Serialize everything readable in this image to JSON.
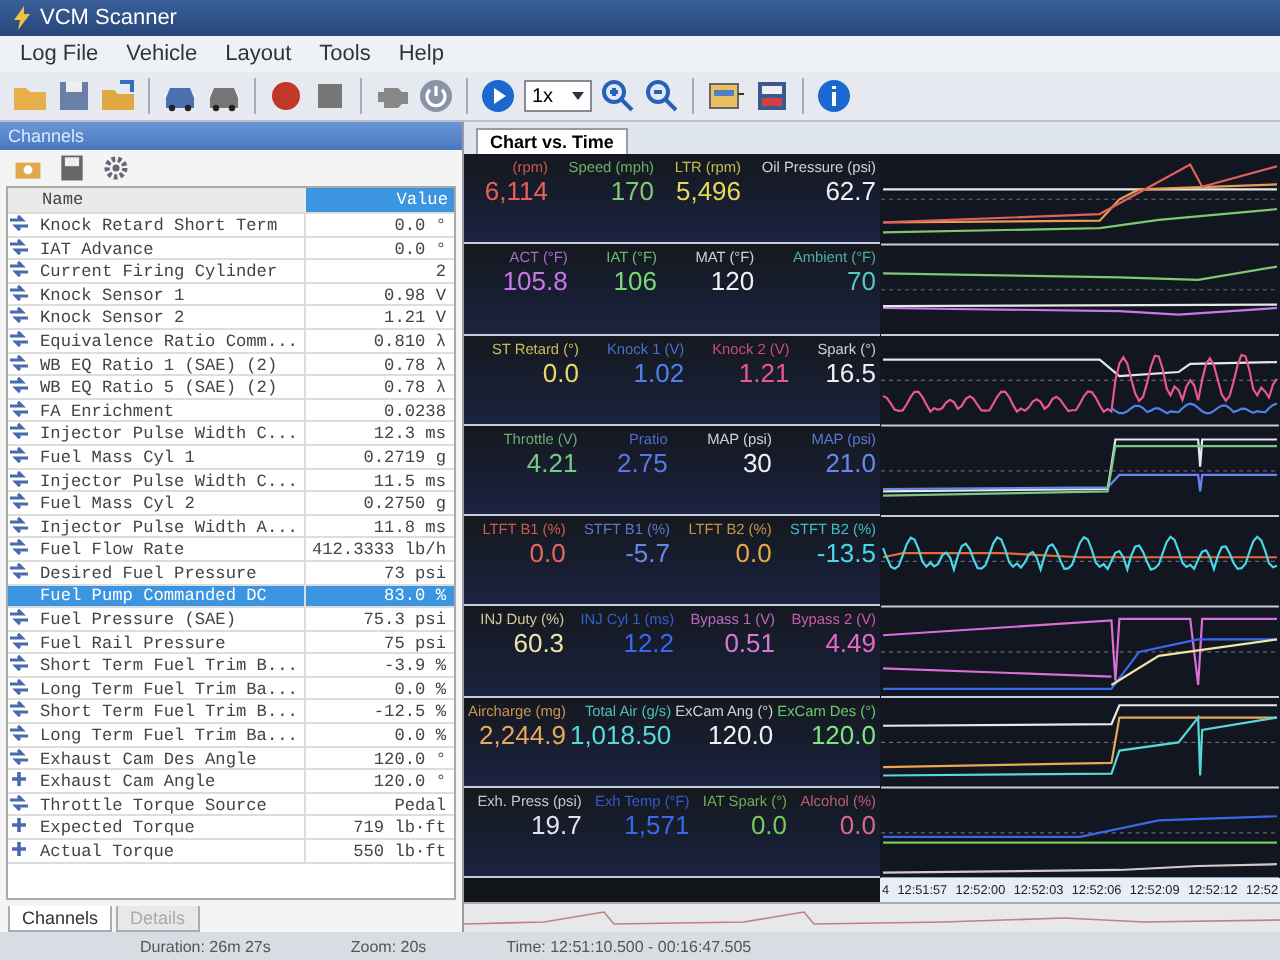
{
  "window": {
    "title": "VCM Scanner"
  },
  "menu": [
    "Log File",
    "Vehicle",
    "Layout",
    "Tools",
    "Help"
  ],
  "toolbar": {
    "speed": "1x"
  },
  "channels_panel": {
    "title": "Channels",
    "columns": [
      {
        "label": "Name",
        "selected": false
      },
      {
        "label": "Value",
        "selected": true
      }
    ],
    "rows": [
      {
        "name": "Knock Retard Short Term",
        "value": "0.0 °",
        "kind": "dual",
        "selected": false
      },
      {
        "name": "IAT Advance",
        "value": "0.0 °",
        "kind": "dual",
        "selected": false
      },
      {
        "name": "Current Firing Cylinder",
        "value": "2",
        "kind": "dual",
        "selected": false
      },
      {
        "name": "Knock Sensor 1",
        "value": "0.98 V",
        "kind": "dual",
        "selected": false
      },
      {
        "name": "Knock Sensor 2",
        "value": "1.21 V",
        "kind": "dual",
        "selected": false
      },
      {
        "name": "Equivalence Ratio Comm...",
        "value": "0.810 λ",
        "kind": "dual",
        "selected": false
      },
      {
        "name": "WB EQ Ratio 1 (SAE) (2)",
        "value": "0.78 λ",
        "kind": "dual",
        "selected": false
      },
      {
        "name": "WB EQ Ratio 5 (SAE) (2)",
        "value": "0.78 λ",
        "kind": "dual",
        "selected": false
      },
      {
        "name": "FA Enrichment",
        "value": "0.0238",
        "kind": "dual",
        "selected": false
      },
      {
        "name": "Injector Pulse Width C...",
        "value": "12.3 ms",
        "kind": "dual",
        "selected": false
      },
      {
        "name": "Fuel Mass Cyl 1",
        "value": "0.2719 g",
        "kind": "dual",
        "selected": false
      },
      {
        "name": "Injector Pulse Width C...",
        "value": "11.5 ms",
        "kind": "dual",
        "selected": false
      },
      {
        "name": "Fuel Mass Cyl 2",
        "value": "0.2750 g",
        "kind": "dual",
        "selected": false
      },
      {
        "name": "Injector Pulse Width A...",
        "value": "11.8 ms",
        "kind": "dual",
        "selected": false
      },
      {
        "name": "Fuel Flow Rate",
        "value": "412.3333 lb/h",
        "kind": "dual",
        "selected": false
      },
      {
        "name": "Desired Fuel Pressure",
        "value": "73 psi",
        "kind": "dual",
        "selected": false
      },
      {
        "name": "Fuel Pump Commanded DC",
        "value": "83.0 %",
        "kind": "none",
        "selected": true
      },
      {
        "name": "Fuel Pressure (SAE)",
        "value": "75.3 psi",
        "kind": "dual",
        "selected": false
      },
      {
        "name": "Fuel Rail Pressure",
        "value": "75 psi",
        "kind": "dual",
        "selected": false
      },
      {
        "name": "Short Term Fuel Trim B...",
        "value": "-3.9 %",
        "kind": "dual",
        "selected": false
      },
      {
        "name": "Long Term Fuel Trim Ba...",
        "value": "0.0 %",
        "kind": "dual",
        "selected": false
      },
      {
        "name": "Short Term Fuel Trim B...",
        "value": "-12.5 %",
        "kind": "dual",
        "selected": false
      },
      {
        "name": "Long Term Fuel Trim Ba...",
        "value": "0.0 %",
        "kind": "dual",
        "selected": false
      },
      {
        "name": "Exhaust Cam Des Angle",
        "value": "120.0 °",
        "kind": "dual",
        "selected": false
      },
      {
        "name": "Exhaust Cam Angle",
        "value": "120.0 °",
        "kind": "single",
        "selected": false
      },
      {
        "name": "Throttle Torque Source",
        "value": "Pedal",
        "kind": "dual",
        "selected": false
      },
      {
        "name": "Expected Torque",
        "value": "719 lb·ft",
        "kind": "single",
        "selected": false
      },
      {
        "name": "Actual Torque",
        "value": "550 lb·ft",
        "kind": "single",
        "selected": false
      }
    ],
    "tabs": [
      {
        "label": "Channels",
        "selected": true
      },
      {
        "label": "Details",
        "selected": false
      }
    ]
  },
  "chart_tab": {
    "label": "Chart vs. Time"
  },
  "gauge_groups": [
    {
      "items": [
        {
          "label": "(rpm)",
          "value": "6,114",
          "color": "#e86058"
        },
        {
          "label": "Speed (mph)",
          "value": "170",
          "color": "#80c870"
        },
        {
          "label": "LTR (rpm)",
          "value": "5,496",
          "color": "#e8d858"
        },
        {
          "label": "Oil Pressure (psi)",
          "value": "62.7",
          "color": "#f0f0f0"
        }
      ]
    },
    {
      "items": [
        {
          "label": "ACT (°F)",
          "value": "105.8",
          "color": "#c878e8"
        },
        {
          "label": "IAT (°F)",
          "value": "106",
          "color": "#78d878"
        },
        {
          "label": "MAT (°F)",
          "value": "120",
          "color": "#f0f0f0"
        },
        {
          "label": "Ambient (°F)",
          "value": "70",
          "color": "#58c8b8"
        }
      ]
    },
    {
      "items": [
        {
          "label": "ST Retard (°)",
          "value": "0.0",
          "color": "#e8d868"
        },
        {
          "label": "Knock 1 (V)",
          "value": "1.02",
          "color": "#5080e8"
        },
        {
          "label": "Knock 2 (V)",
          "value": "1.21",
          "color": "#e85888"
        },
        {
          "label": "Spark (°)",
          "value": "16.5",
          "color": "#f0f0f0"
        }
      ]
    },
    {
      "items": [
        {
          "label": "Throttle (V)",
          "value": "4.21",
          "color": "#78c888"
        },
        {
          "label": "Pratio",
          "value": "2.75",
          "color": "#5878e8"
        },
        {
          "label": "MAP (psi)",
          "value": "30",
          "color": "#f0f0f0"
        },
        {
          "label": "MAP (psi)",
          "value": "21.0",
          "color": "#6888f0"
        }
      ]
    },
    {
      "items": [
        {
          "label": "LTFT B1 (%)",
          "value": "0.0",
          "color": "#e86858"
        },
        {
          "label": "STFT B1 (%)",
          "value": "-5.7",
          "color": "#6888e8"
        },
        {
          "label": "LTFT B2 (%)",
          "value": "0.0",
          "color": "#e8a848"
        },
        {
          "label": "STFT B2 (%)",
          "value": "-13.5",
          "color": "#48d8e8"
        }
      ]
    },
    {
      "items": [
        {
          "label": "INJ Duty (%)",
          "value": "60.3",
          "color": "#f0e4a8"
        },
        {
          "label": "INJ Cyl 1 (ms)",
          "value": "12.2",
          "color": "#3868f0"
        },
        {
          "label": "Bypass 1 (V)",
          "value": "0.51",
          "color": "#d878d8"
        },
        {
          "label": "Bypass 2 (V)",
          "value": "4.49",
          "color": "#e868c8"
        }
      ]
    },
    {
      "items": [
        {
          "label": "Aircharge (mg)",
          "value": "2,244.9",
          "color": "#e8a858"
        },
        {
          "label": "Total Air (g/s)",
          "value": "1,018.50",
          "color": "#58d8d8"
        },
        {
          "label": "ExCam Ang (°)",
          "value": "120.0",
          "color": "#f0f0f0"
        },
        {
          "label": "ExCam Des (°)",
          "value": "120.0",
          "color": "#78e878"
        }
      ]
    },
    {
      "items": [
        {
          "label": "Exh. Press (psi)",
          "value": "19.7",
          "color": "#e8e0f0"
        },
        {
          "label": "Exh Temp (°F)",
          "value": "1,571",
          "color": "#3868e8"
        },
        {
          "label": "IAT Spark (°)",
          "value": "0.0",
          "color": "#78c858"
        },
        {
          "label": "Alcohol (%)",
          "value": "0.0",
          "color": "#d86888"
        }
      ]
    }
  ],
  "time_axis": {
    "ticks": [
      "4",
      "12:51:57",
      "12:52:00",
      "12:52:03",
      "12:52:06",
      "12:52:09",
      "12:52:12",
      "12:52"
    ]
  },
  "status_bar": [
    "Duration: 26m 27s",
    "Zoom: 20s",
    "Time: 12:51:10.500 - 00:16:47.505"
  ]
}
